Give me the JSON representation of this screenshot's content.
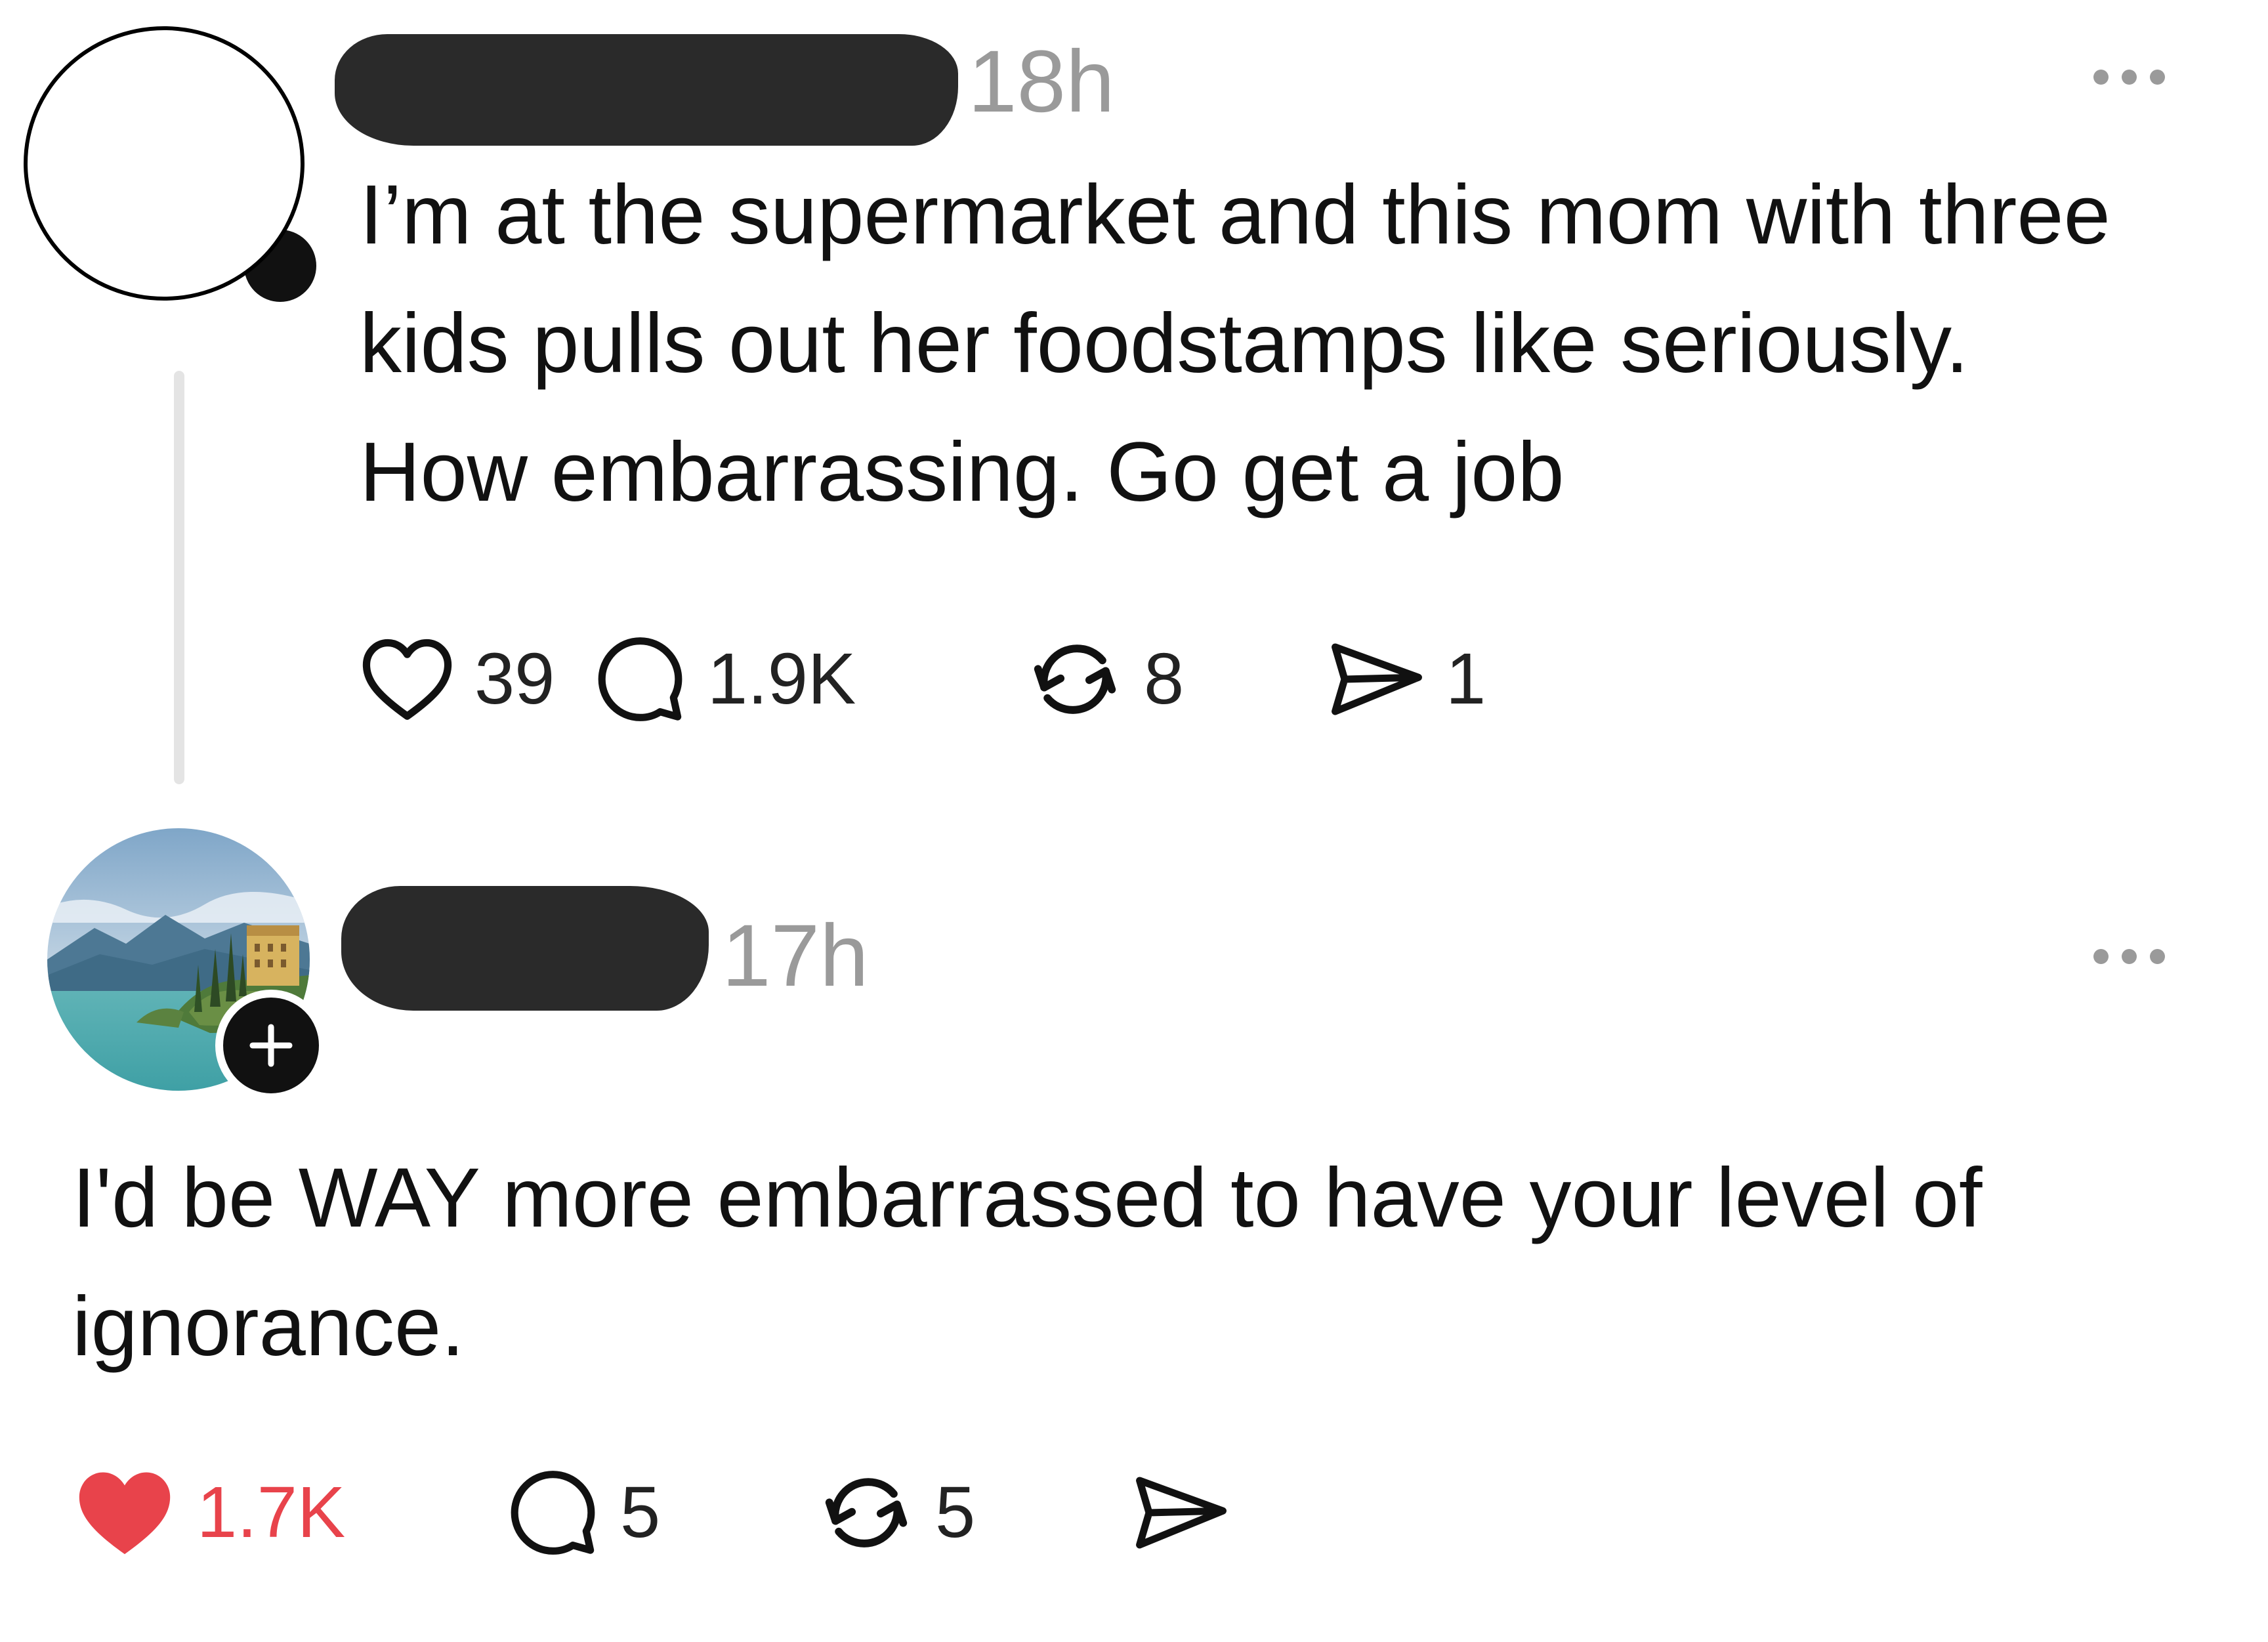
{
  "post": {
    "time": "18h",
    "text": "I’m at the supermarket and this mom with three kids pulls out her foodstamps like seriously. How embarrassing. Go get a job",
    "likes": "39",
    "replies": "1.9K",
    "reposts": "8",
    "shares": "1"
  },
  "reply": {
    "time": "17h",
    "text": "I'd be WAY more embarrassed to have your level of ignorance.",
    "likes": "1.7K",
    "replies": "5",
    "reposts": "5",
    "shares": ""
  },
  "icons": {
    "like": "heart-icon",
    "reply": "speech-bubble-icon",
    "repost": "repost-icon",
    "share": "paper-plane-icon",
    "more": "ellipsis-icon",
    "follow": "plus-icon"
  },
  "colors": {
    "liked": "#e8434b",
    "muted": "#9a9a9a",
    "text": "#111111",
    "redaction": "#2a2a2a"
  }
}
